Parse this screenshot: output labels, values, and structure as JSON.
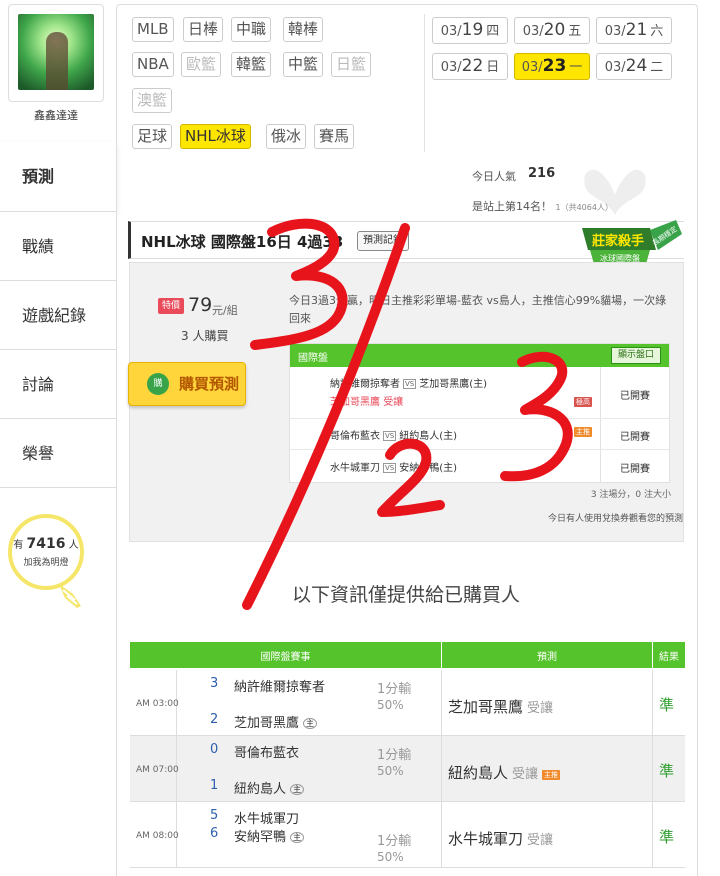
{
  "user": {
    "name": "鑫鑫達達"
  },
  "sidebar": {
    "items": [
      {
        "label": "預測"
      },
      {
        "label": "戰績"
      },
      {
        "label": "遊戲紀錄"
      },
      {
        "label": "討論"
      },
      {
        "label": "榮譽"
      }
    ]
  },
  "bulb": {
    "prefix": "有",
    "count": "7416",
    "suffix": "人",
    "line2": "加我為明燈"
  },
  "sports": {
    "tags": [
      "MLB",
      "日棒",
      "中職",
      "韓棒",
      "NBA",
      "歐籃",
      "韓籃",
      "中籃",
      "日籃",
      "澳籃",
      "足球",
      "NHL冰球",
      "俄冰",
      "賽馬"
    ],
    "selected": "NHL冰球"
  },
  "dates": [
    {
      "md": "03/",
      "d": "19",
      "w": "四"
    },
    {
      "md": "03/",
      "d": "20",
      "w": "五"
    },
    {
      "md": "03/",
      "d": "21",
      "w": "六"
    },
    {
      "md": "03/",
      "d": "22",
      "w": "日"
    },
    {
      "md": "03/",
      "d": "23",
      "w": "一",
      "selected": true
    },
    {
      "md": "03/",
      "d": "24",
      "w": "二"
    }
  ],
  "popularity": {
    "label": "今日人氣",
    "value": "216",
    "rank": "是站上第14名！",
    "rank_sub": "1（共4064人）"
  },
  "title": {
    "text": "NHL冰球 國際盤16日 4過33",
    "record_button": "預測記錄"
  },
  "badge": {
    "line1": "莊家殺手",
    "line2": "冰球國際盤",
    "ribbon": "長期穩定"
  },
  "purchase": {
    "price_tag": "特價",
    "price": "79",
    "unit": "元/組",
    "buyers": "3 人購買",
    "button": "購買預測",
    "button_icon": "購"
  },
  "description": "今日3過3全贏，明日主推彩彩單場-藍衣 vs島人，主推信心99%貓場，一次綠回來",
  "game_box": {
    "header": "國際盤",
    "show_button": "顯示盤口",
    "rows": [
      {
        "away": "納許維爾掠奪者",
        "home": "芝加哥黑鷹(主)",
        "pick": "芝加哥黑鷹",
        "pick_note": "受讓",
        "tag": "極高",
        "status": "已開賽"
      },
      {
        "away": "哥倫布藍衣",
        "home": "紐約島人(主)",
        "tag": "主推",
        "status": "已開賽"
      },
      {
        "away": "水牛城軍刀",
        "home": "安納罕鴨(主)",
        "status": "已開賽"
      }
    ],
    "summary": "3 注場分，0 注大小",
    "coupon": "今日有人使用兌換券觀看您的預測"
  },
  "notice": "以下資訊僅提供給已購買人",
  "results": {
    "headers": [
      "國際盤賽事",
      "預測",
      "結果"
    ],
    "rows": [
      {
        "time": "AM 03:00",
        "s1": "3",
        "t1": "納許維爾掠奪者",
        "s2": "2",
        "t2": "芝加哥黑鷹",
        "host": "主",
        "line1": "1分輸",
        "line2": "50%",
        "pred": "芝加哥黑鷹",
        "handicap": "受讓",
        "tag": "",
        "result": "準"
      },
      {
        "time": "AM 07:00",
        "s1": "0",
        "t1": "哥倫布藍衣",
        "s2": "1",
        "t2": "紐約島人",
        "host": "主",
        "line1": "1分輸",
        "line2": "50%",
        "pred": "紐約島人",
        "handicap": "受讓",
        "tag": "主推",
        "result": "準"
      },
      {
        "time": "AM 08:00",
        "s1": "5",
        "t1": "水牛城軍刀",
        "s2": "6",
        "t2": "安納罕鴨",
        "host": "主",
        "line1": "1分輸",
        "line2": "50%",
        "pred": "水牛城軍刀",
        "handicap": "受讓",
        "tag": "",
        "result": "準"
      }
    ]
  },
  "overlay": {
    "handwritten_text": "3/23",
    "color": "#e8141c"
  },
  "colors": {
    "accent_green": "#55c32b",
    "selected_yellow": "#ffe600",
    "price_red": "#e94b5b"
  }
}
